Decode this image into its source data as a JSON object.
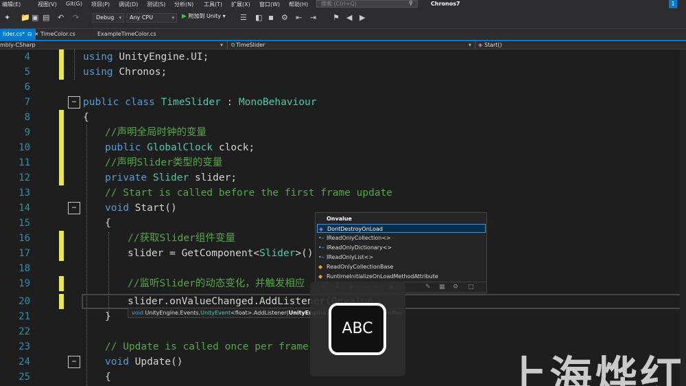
{
  "menu": {
    "items": [
      "编辑(E)",
      "视图(V)",
      "Git(G)",
      "项目(P)",
      "调试(D)",
      "测试(S)",
      "分析(N)",
      "工具(T)",
      "扩展(X)",
      "窗口(W)",
      "帮助(H)"
    ],
    "search_placeholder": "搜索 (Ctrl+Q)",
    "solution_name": "Chronos7",
    "notification_count": "1"
  },
  "toolbar": {
    "config": "Debug",
    "platform": "Any CPU",
    "run_label": "附加到 Unity"
  },
  "tabs": [
    {
      "label": "lider.cs*",
      "active": true
    },
    {
      "label": "TimeColor.cs",
      "active": false
    },
    {
      "label": "ExampleTimeColor.cs",
      "active": false
    }
  ],
  "navbar": {
    "project": "mbly-CSharp",
    "class": "TimeSlider",
    "member": "Start()"
  },
  "code": {
    "line_numbers": [
      "4",
      "5",
      "6",
      "7",
      "8",
      "9",
      "10",
      "11",
      "12",
      "13",
      "14",
      "15",
      "16",
      "17",
      "18",
      "19",
      "20",
      "21",
      "22",
      "23",
      "24",
      "25"
    ],
    "l4_kw": "using",
    "l4_rest": " UnityEngine.UI;",
    "l5_kw": "using",
    "l5_rest": " Chronos;",
    "l7_kw1": "public",
    "l7_kw2": " class",
    "l7_name": " TimeSlider",
    "l7_colon": " : ",
    "l7_base": "MonoBehaviour",
    "l8": "{",
    "l9": "//声明全局时钟的变量",
    "l10_kw": "public",
    "l10_type": " GlobalClock",
    "l10_rest": " clock;",
    "l11": "//声明Slider类型的变量",
    "l12_kw": "private",
    "l12_type": " Slider",
    "l12_rest": " slider;",
    "l13": "// Start is called before the first frame update",
    "l14_kw": "void",
    "l14_rest": " Start()",
    "l15": "{",
    "l16": "//获取Slider组件变量",
    "l17_a": "slider = GetComponent<",
    "l17_type": "Slider",
    "l17_b": ">();",
    "l19": "//监听Slider的动态变化，并触发相应",
    "l20": "slider.onValueChanged.AddListener(Onvalue",
    "l21": "}",
    "l23": "// Update is called once per frame",
    "l24_kw": "void",
    "l24_rest": " Update()",
    "l25": "{"
  },
  "intellisense": {
    "title": "Onvalue",
    "items": [
      "DontDestroyOnLoad",
      "IReadOnlyCollection<>",
      "IReadOnlyDictionary<>",
      "IReadOnlyList<>",
      "ReadOnlyCollectionBase",
      "RuntimeInitializeOnLoadMethodAttribute"
    ]
  },
  "signature": {
    "void_kw": "void",
    "ns": " UnityEngine.Events.",
    "type": "UnityEvent",
    "generic": "<float>",
    "method": ".AddListener(",
    "param": "UnityEngine.Events.UnityAction<float> call",
    "close": ")"
  },
  "ime": {
    "label": "ABC"
  },
  "watermark": {
    "text": "上海烨红"
  }
}
